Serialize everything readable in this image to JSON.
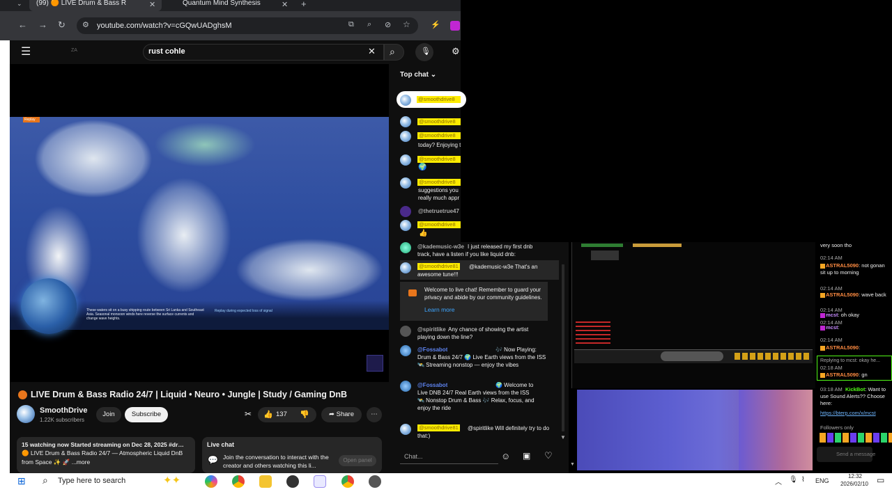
{
  "browser": {
    "tabs": [
      {
        "label": "(99) 🟠 LIVE Drum & Bass R"
      },
      {
        "label": "Quantum Mind Synthesis"
      }
    ],
    "url": "youtube.com/watch?v=cGQwUADghsM"
  },
  "youtube": {
    "search_value": "rust cohle",
    "video_title": "LIVE Drum & Bass Radio 24/7 | Liquid • Neuro • Jungle | Study / Gaming DnB",
    "channel_name": "SmoothDrive",
    "subscribers": "1.22K subscribers",
    "join_label": "Join",
    "subscribe_label": "Subscribe",
    "likes": "137",
    "share_label": "Share",
    "description": {
      "line1": "15 watching now  Started streaming on Dec 28, 2025  #dr…",
      "line2": "🟠 LIVE Drum & Bass Radio 24/7 — Atmospheric Liquid DnB",
      "line3": "from Space ✨ 🚀  ...more"
    },
    "live_chat_box": {
      "title": "Live chat",
      "desc": "Join the conversation to interact with the creator and others watching this li...",
      "open_panel": "Open panel"
    },
    "video_overlay": {
      "replay": "Replay",
      "caption": "These waters sit on a busy shipping route between Sri Lanka and Southeast Asia. Seasonal monsoon winds here reverse the surface currents and change wave heights.",
      "signal": "Replay during expected loss of signal"
    }
  },
  "chat": {
    "header": "Top chat",
    "messages": [
      {
        "user": "@smoothdrive8",
        "text": ""
      },
      {
        "user": "@smoothdrive8",
        "text": "today? Enjoying t"
      },
      {
        "user": "@smoothdrive8",
        "text": ""
      },
      {
        "user": "@smoothdrive8",
        "text": "suggestions you"
      },
      {
        "user": "",
        "text": "really much appr"
      },
      {
        "user": "@thetruetrue47",
        "text": ""
      },
      {
        "user": "@smoothdrive8",
        "text": "👍"
      },
      {
        "user": "@kademusic-w3e",
        "text": "I just released my first dnb track, have a listen if you like liquid dnb:"
      },
      {
        "user": "@smoothdrive81",
        "text": "@kademusic-w3e That's an awesome tune!!!"
      },
      {
        "user": "@spiritlike",
        "text": "Any chance of showing the artist playing down the line?"
      },
      {
        "user": "@Fossabot",
        "text": "🎶 Now Playing: Drum & Bass 24/7 🌍 Live Earth views from the ISS 🛰️ Streaming nonstop — enjoy the vibes"
      },
      {
        "user": "@Fossabot",
        "text": "🌍 Welcome to Live DNB 24/7 Real Earth views from the ISS 🛰️ Nonstop Drum & Bass 🎶 Relax, focus, and enjoy the ride"
      },
      {
        "user": "@smoothdrive81",
        "text": "@spiritlike Will definitely try to do that:)"
      }
    ],
    "welcome": "Welcome to live chat! Remember to guard your privacy and abide by our community guidelines.",
    "learn_more": "Learn more",
    "input_placeholder": "Chat..."
  },
  "kick_chat": {
    "lines": [
      {
        "time": "",
        "user": "",
        "text": "very soon tho"
      },
      {
        "time": "02:14 AM",
        "user": "ASTRAL5090",
        "text": ": not gonan sit up to morning"
      },
      {
        "time": "02:14 AM",
        "user": "ASTRAL5090",
        "text": ": wave back"
      },
      {
        "time": "02:14 AM",
        "user": "mcst",
        "text": ": oh okay"
      },
      {
        "time": "02:14 AM",
        "user": "mcst",
        "text": ":"
      },
      {
        "time": "02:14 AM",
        "user": "ASTRAL5090",
        "text": ":"
      },
      {
        "time": "",
        "user": "",
        "text": "Replying to mcst: okay he..."
      },
      {
        "time": "02:18 AM",
        "user": "ASTRAL5090",
        "text": ": gn"
      },
      {
        "time": "03:18 AM",
        "user": "KickBot",
        "text": ": Want to use Sound Alerts?? Choose here:"
      },
      {
        "time": "",
        "user": "",
        "text": "https://bterp.com/x/mcst"
      }
    ],
    "followers_only": "Followers only",
    "send_message": "Send a message"
  },
  "taskbar": {
    "search_placeholder": "Type here to search",
    "language": "ENG",
    "time": "12:32",
    "date": "2026/02/10"
  },
  "colors": {
    "youtube_bg": "#0f0f0f",
    "highlight_yellow": "#fdeb00",
    "live_orange": "#e8761c",
    "link_blue": "#3ea6ff",
    "kick_green": "#53fc18"
  }
}
